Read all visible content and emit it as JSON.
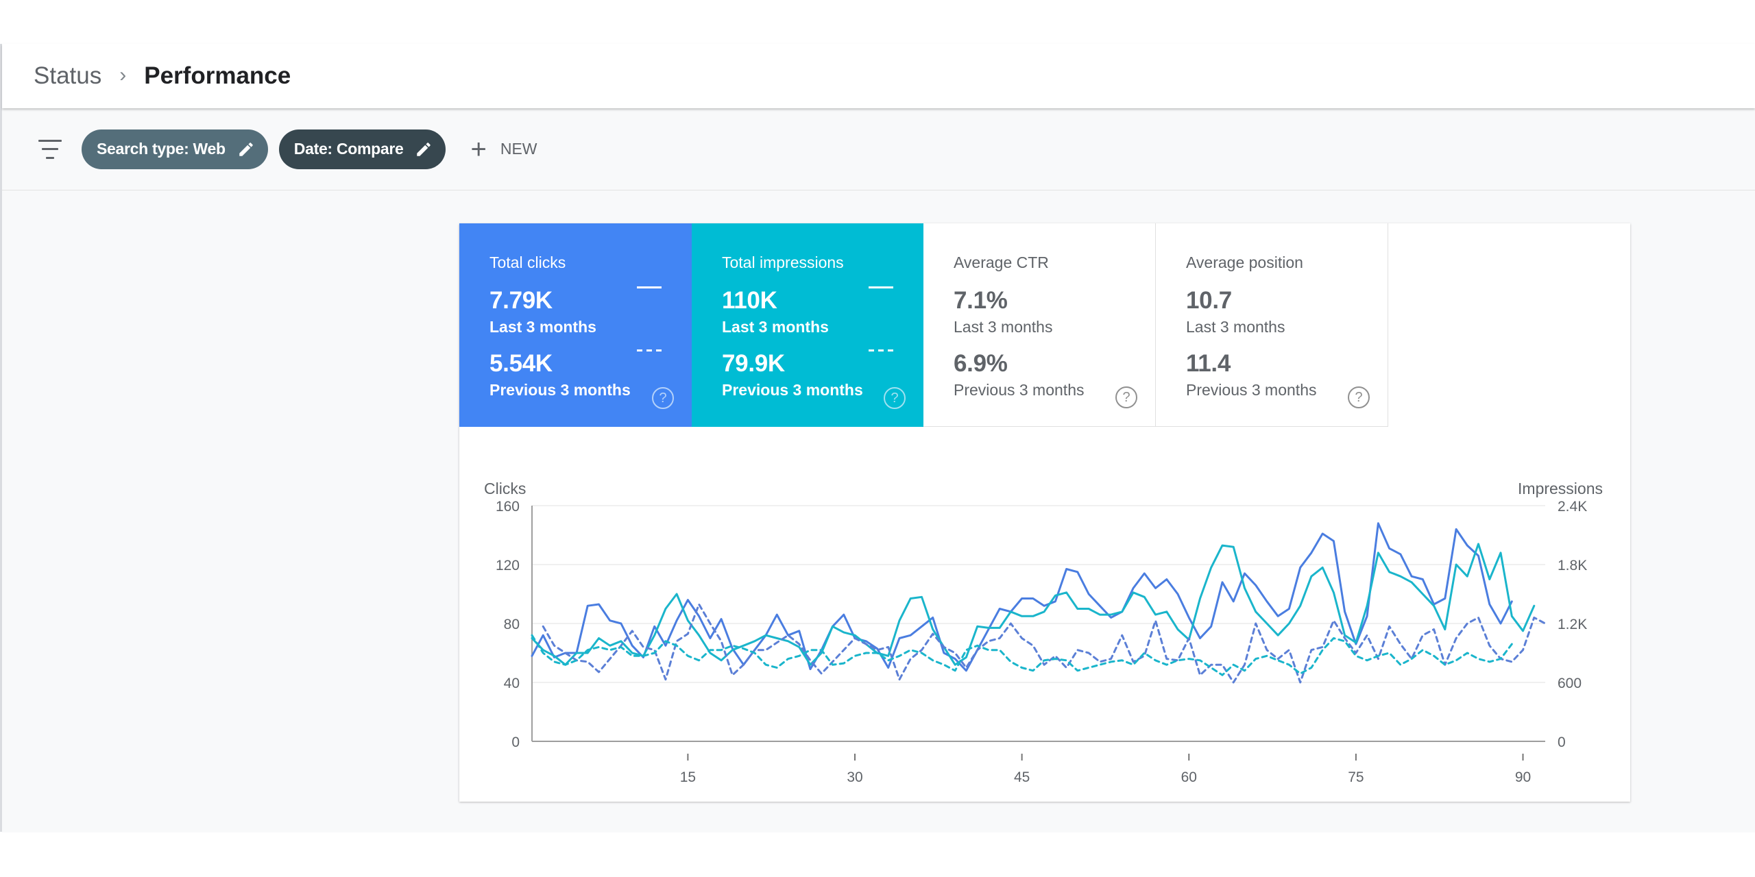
{
  "breadcrumb": {
    "parent": "Status",
    "separator": "›",
    "current": "Performance"
  },
  "filters": {
    "chips": [
      "Search type: Web",
      "Date: Compare"
    ],
    "new_label": "NEW"
  },
  "tiles": [
    {
      "title": "Total clicks",
      "current_value": "7.79K",
      "current_label": "Last 3 months",
      "previous_value": "5.54K",
      "previous_label": "Previous 3 months",
      "color": "#4285f4"
    },
    {
      "title": "Total impressions",
      "current_value": "110K",
      "current_label": "Last 3 months",
      "previous_value": "79.9K",
      "previous_label": "Previous 3 months",
      "color": "#00bcd4"
    },
    {
      "title": "Average CTR",
      "current_value": "7.1%",
      "current_label": "Last 3 months",
      "previous_value": "6.9%",
      "previous_label": "Previous 3 months"
    },
    {
      "title": "Average position",
      "current_value": "10.7",
      "current_label": "Last 3 months",
      "previous_value": "11.4",
      "previous_label": "Previous 3 months"
    }
  ],
  "chart_data": {
    "type": "line",
    "left_axis": {
      "label": "Clicks",
      "ticks": [
        0,
        40,
        80,
        120,
        160
      ],
      "range": [
        0,
        160
      ]
    },
    "right_axis": {
      "label": "Impressions",
      "ticks": [
        "0",
        "600",
        "1.2K",
        "1.8K",
        "2.4K"
      ],
      "range": [
        0,
        2400
      ]
    },
    "x_ticks": [
      15,
      30,
      45,
      60,
      75,
      90
    ],
    "x_range": [
      1,
      92
    ],
    "grid": true,
    "series": [
      {
        "axis": "left",
        "style": "solid",
        "color": "#4a7de0",
        "values": [
          58,
          72,
          57,
          60,
          60,
          92,
          93,
          82,
          80,
          65,
          57,
          78,
          65,
          82,
          96,
          85,
          70,
          83,
          63,
          52,
          62,
          72,
          86,
          72,
          75,
          49,
          62,
          78,
          86,
          70,
          68,
          63,
          50,
          70,
          72,
          78,
          84,
          60,
          56,
          48,
          62,
          76,
          90,
          88,
          97,
          97,
          92,
          95,
          117,
          115,
          100,
          92,
          84,
          88,
          104,
          114,
          104,
          110,
          100,
          84,
          70,
          78,
          108,
          95,
          114,
          106,
          95,
          85,
          90,
          118,
          128,
          141,
          136,
          88,
          66,
          85,
          148,
          131,
          127,
          112,
          110,
          93,
          97,
          144,
          133,
          126,
          93,
          80,
          95
        ],
        "x_start": 1
      },
      {
        "axis": "right",
        "style": "solid",
        "color": "#1ab5cb",
        "values": [
          70,
          62,
          58,
          52,
          60,
          60,
          70,
          65,
          68,
          60,
          58,
          72,
          90,
          100,
          82,
          72,
          60,
          55,
          62,
          65,
          68,
          72,
          70,
          68,
          64,
          52,
          60,
          78,
          74,
          72,
          66,
          60,
          58,
          82,
          97,
          98,
          76,
          64,
          52,
          57,
          78,
          77,
          77,
          88,
          85,
          85,
          88,
          99,
          101,
          90,
          90,
          86,
          86,
          88,
          101,
          98,
          86,
          88,
          76,
          69,
          97,
          118,
          133,
          132,
          104,
          88,
          80,
          72,
          80,
          92,
          112,
          118,
          101,
          72,
          67,
          92,
          128,
          115,
          112,
          108,
          100,
          92,
          76,
          120,
          112,
          134,
          110,
          128,
          85,
          75,
          92
        ],
        "x_start": 1
      },
      {
        "axis": "left",
        "style": "dashed",
        "color": "#5b7fd6",
        "values": [
          78,
          65,
          60,
          55,
          54,
          47,
          56,
          65,
          75,
          64,
          62,
          42,
          68,
          73,
          93,
          80,
          68,
          45,
          52,
          62,
          62,
          67,
          72,
          66,
          55,
          46,
          54,
          62,
          70,
          66,
          62,
          64,
          42,
          56,
          62,
          73,
          64,
          60,
          50,
          62,
          68,
          70,
          80,
          70,
          65,
          52,
          58,
          50,
          62,
          60,
          54,
          56,
          72,
          54,
          58,
          82,
          56,
          55,
          70,
          45,
          52,
          52,
          40,
          52,
          80,
          62,
          56,
          62,
          40,
          62,
          64,
          82,
          70,
          60,
          72,
          56,
          78,
          66,
          56,
          72,
          76,
          52,
          70,
          80,
          84,
          65,
          56,
          54,
          62,
          84,
          80
        ],
        "x_start": 2
      },
      {
        "axis": "right",
        "style": "dashed",
        "color": "#1ab5cb",
        "values": [
          72,
          60,
          54,
          52,
          55,
          62,
          64,
          62,
          64,
          58,
          58,
          60,
          68,
          65,
          58,
          55,
          62,
          62,
          65,
          63,
          60,
          52,
          50,
          56,
          58,
          62,
          62,
          52,
          53,
          58,
          60,
          60,
          55,
          58,
          62,
          60,
          55,
          52,
          48,
          62,
          65,
          62,
          62,
          54,
          50,
          48,
          55,
          56,
          55,
          48,
          50,
          52,
          54,
          55,
          52,
          60,
          55,
          52,
          55,
          56,
          55,
          50,
          45,
          52,
          48,
          56,
          58,
          55,
          52,
          46,
          50,
          62,
          70,
          68,
          58,
          55,
          58,
          60,
          52,
          56,
          62,
          58,
          52,
          55,
          60,
          56,
          54,
          56,
          66
        ],
        "x_start": 1
      }
    ]
  }
}
